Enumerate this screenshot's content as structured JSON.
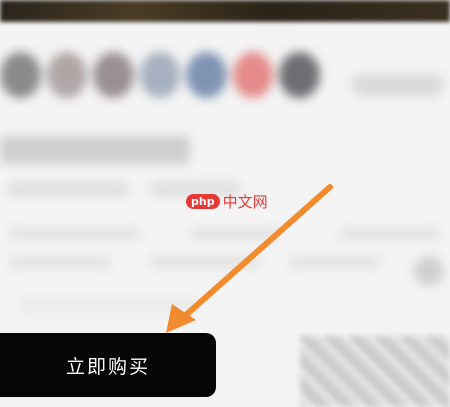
{
  "watermark": {
    "badge": "php",
    "text": "中文网"
  },
  "buy_button": {
    "label": "立即购买"
  },
  "colors": {
    "arrow": "#f28a2e",
    "button_bg": "#050505",
    "watermark_red": "#e53935"
  },
  "icons": {
    "arrow": "arrow-pointer-icon"
  }
}
